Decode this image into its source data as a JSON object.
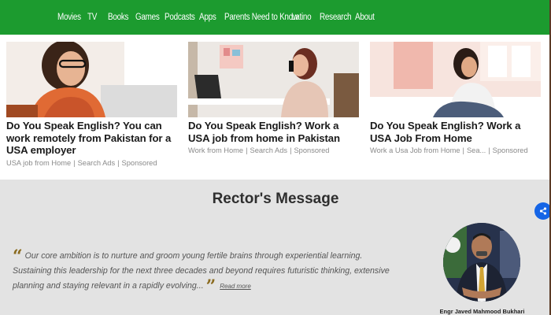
{
  "nav": {
    "items": [
      "Movies",
      "TV",
      "Books",
      "Games",
      "Podcasts",
      "Apps",
      "Parents Need to Know",
      "Latino",
      "Research",
      "About"
    ]
  },
  "ads": [
    {
      "title": "Do You Speak English? You can work remotely from Pakistan for a USA employer",
      "source": "USA job from Home",
      "category": "Search Ads",
      "sponsored": "Sponsored"
    },
    {
      "title": "Do You Speak English? Work a USA job from home in Pakistan",
      "source": "Work from Home",
      "category": "Search Ads",
      "sponsored": "Sponsored"
    },
    {
      "title": "Do You Speak English? Work a USA Job From Home",
      "source": "Work a Usa Job from Home",
      "category": "Sea...",
      "sponsored": "Sponsored"
    }
  ],
  "rector": {
    "heading": "Rector's Message",
    "quote": "Our core ambition is to nurture and groom young fertile brains through experiential learning. Sustaining this leadership for the next three decades and beyond requires futuristic thinking, extensive planning and staying relevant in a rapidly evolving...",
    "read_more": "Read more",
    "name": "Engr Javed Mahmood Bukhari"
  },
  "colors": {
    "nav_bg": "#1c9b2f",
    "section_bg": "#e3e3e3",
    "quote_mark": "#8a6a1e",
    "share_button": "#1565e6"
  },
  "icons": {
    "share": "share-icon",
    "open_quote": "open-quote-icon",
    "close_quote": "close-quote-icon"
  }
}
